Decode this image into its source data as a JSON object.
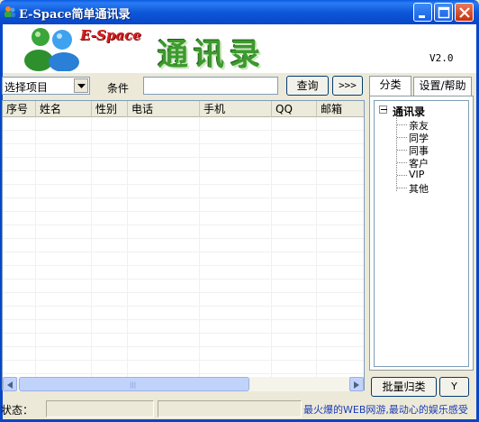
{
  "window": {
    "title": "E-Space简单通讯录"
  },
  "banner": {
    "brand": "E-Space",
    "title": "通讯录",
    "version": "V2.0"
  },
  "toolbar": {
    "select_value": "选择项目",
    "condition_label": "条件",
    "condition_value": "",
    "query_label": "查询",
    "more_label": ">>>"
  },
  "table": {
    "columns": [
      "序号",
      "姓名",
      "性别",
      "电话",
      "手机",
      "QQ",
      "邮箱"
    ],
    "rows": []
  },
  "side": {
    "tabs": [
      "分类",
      "设置/帮助"
    ],
    "tree_root": "通讯录",
    "tree_items": [
      "亲友",
      "同学",
      "同事",
      "客户",
      "VIP",
      "其他"
    ],
    "batch_label": "批量归类",
    "y_label": "Y"
  },
  "status": {
    "label": "状态：",
    "message": "最火爆的WEB网游,最动心的娱乐感受"
  },
  "colors": {
    "titlebar": "#0846c8",
    "brand": "#d62020",
    "title_green": "#3d9a2e",
    "status_link": "#1a3cb8"
  }
}
